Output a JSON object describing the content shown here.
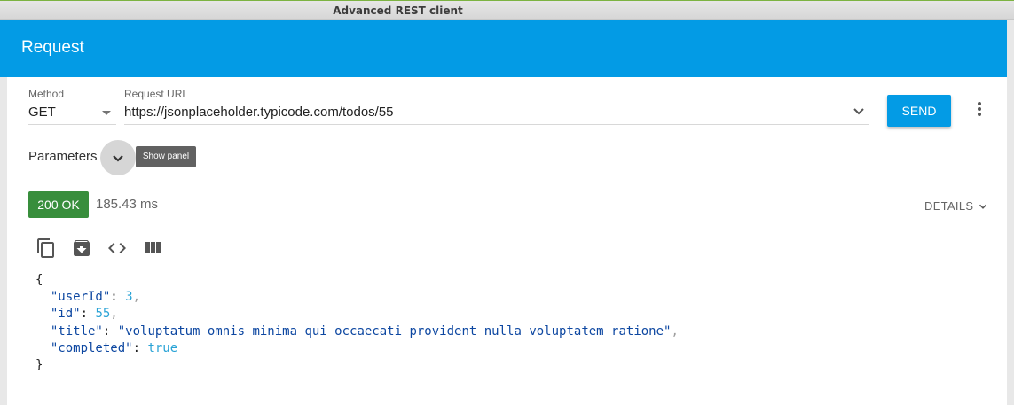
{
  "window": {
    "title": "Advanced REST client"
  },
  "header": {
    "title": "Request"
  },
  "request": {
    "method_label": "Method",
    "method_value": "GET",
    "url_label": "Request URL",
    "url_value": "https://jsonplaceholder.typicode.com/todos/55",
    "send_label": "SEND"
  },
  "parameters": {
    "label": "Parameters",
    "tooltip": "Show panel"
  },
  "response": {
    "status": "200 OK",
    "status_color": "#388e3c",
    "time": "185.43 ms",
    "details_label": "DETAILS",
    "toolbar_icons": [
      "copy-icon",
      "archive-download-icon",
      "code-icon",
      "columns-icon"
    ],
    "body": {
      "open_brace": "{",
      "close_brace": "}",
      "lines": [
        {
          "key": "\"userId\"",
          "value": "3",
          "type": "num",
          "comma": ","
        },
        {
          "key": "\"id\"",
          "value": "55",
          "type": "num",
          "comma": ","
        },
        {
          "key": "\"title\"",
          "value": "\"voluptatum omnis minima qui occaecati provident nulla voluptatem ratione\"",
          "type": "str",
          "comma": ","
        },
        {
          "key": "\"completed\"",
          "value": "true",
          "type": "bool",
          "comma": ""
        }
      ]
    }
  },
  "colors": {
    "accent": "#039be5",
    "send_button": "#039be5"
  }
}
